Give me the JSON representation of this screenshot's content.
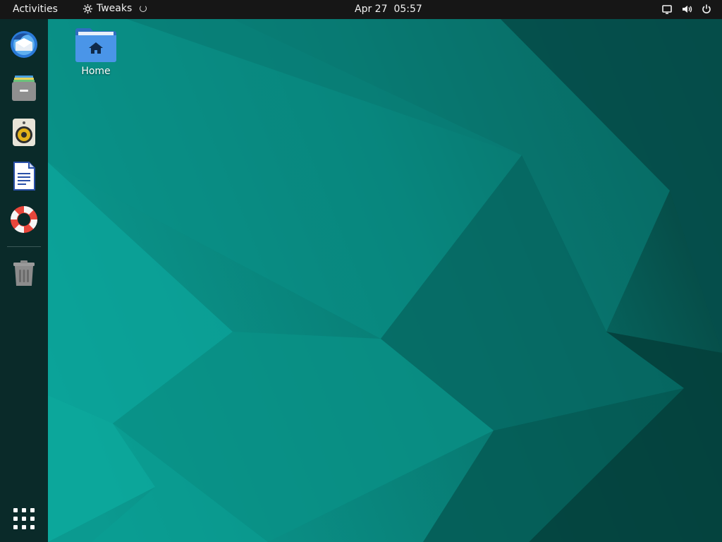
{
  "topbar": {
    "activities_label": "Activities",
    "app_name": "Tweaks",
    "clock_date": "Apr 27",
    "clock_time": "05:57",
    "status_icons": [
      "display-icon",
      "volume-icon",
      "power-icon"
    ]
  },
  "dock": {
    "items": [
      {
        "name": "thunderbird-mail-icon"
      },
      {
        "name": "files-icon"
      },
      {
        "name": "rhythmbox-speaker-icon"
      },
      {
        "name": "writer-document-icon"
      },
      {
        "name": "help-lifebuoy-icon"
      },
      {
        "name": "trash-icon"
      }
    ],
    "apps_grid_icon": "show-applications-icon"
  },
  "desktop": {
    "icons": [
      {
        "label": "Home",
        "icon": "home-folder-icon"
      }
    ]
  },
  "colors": {
    "topbar_bg": "#161616",
    "dock_bg": "#0a2a29",
    "wallpaper_base": "#0f6b65",
    "wallpaper_light": "#0c9e94",
    "wallpaper_dark": "#06403c",
    "folder_blue": "#3f8ae0"
  }
}
